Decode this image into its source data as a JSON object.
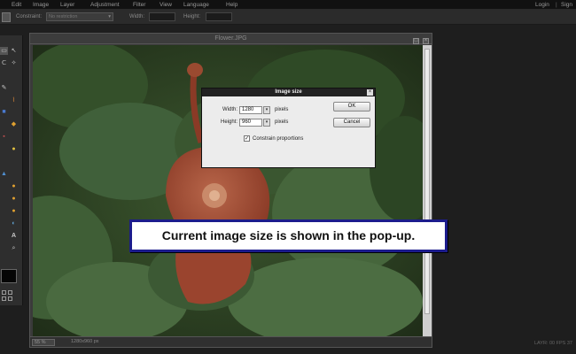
{
  "menubar": {
    "items": [
      "Edit",
      "Image",
      "Layer",
      "Adjustment",
      "Filter",
      "View",
      "Language",
      "Help"
    ],
    "login": "Login",
    "signup": "Sign"
  },
  "options": {
    "constraint_label": "Constraint:",
    "constraint_value": "No restriction",
    "width_label": "Width:",
    "height_label": "Height:"
  },
  "document": {
    "title": "Flower.JPG",
    "zoom": "55 %",
    "dimensions": "1280x960 px"
  },
  "dialog": {
    "title": "Image size",
    "width_label": "Width:",
    "width_value": "1280",
    "height_label": "Height:",
    "height_value": "960",
    "unit": "pixels",
    "constrain_label": "Constrain proportions",
    "constrain_checked": true,
    "ok_label": "OK",
    "cancel_label": "Cancel"
  },
  "callout": {
    "text": "Current image size is shown in the pop-up."
  },
  "status": {
    "bottom_right": "LAYR: 00 FPS 37"
  },
  "colors": {
    "callout_border": "#1c1c8c",
    "dialog_title_bg": "#222222",
    "canvas_bg": "#2c3d24"
  }
}
